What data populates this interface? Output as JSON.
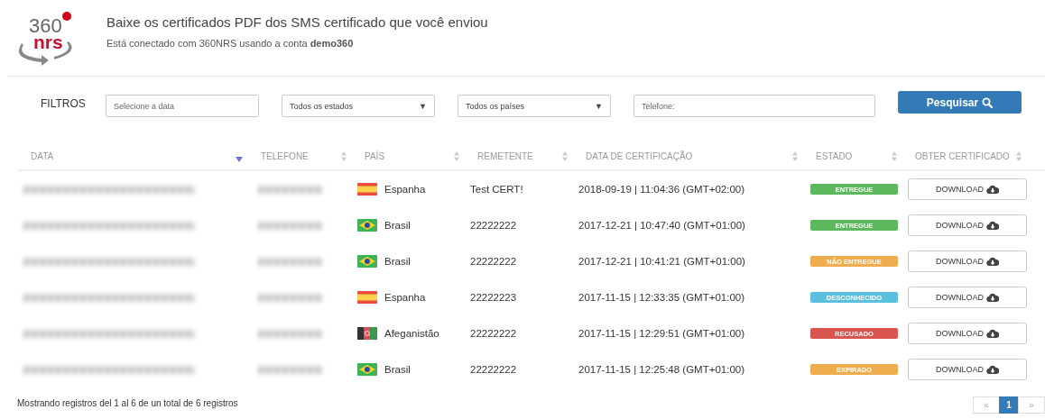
{
  "header": {
    "title": "Baixe os certificados PDF dos SMS certificado que você enviou",
    "subtitle": "Está conectado com 360NRS usando a conta **demo360**",
    "logo_text": "360",
    "logo_brand": "nrs"
  },
  "filters": {
    "label": "FILTROS",
    "date": {
      "placeholder": "Selecione a data"
    },
    "state": {
      "value": "Todos os estados",
      "arrow": "▼"
    },
    "country": {
      "value": "Todos os países",
      "arrow": "▼"
    },
    "phone": {
      "placeholder": "Telefone:"
    },
    "search_button": "Pesquisar"
  },
  "table": {
    "columns": [
      {
        "label": "DATA",
        "sorted": true
      },
      {
        "label": "TELEFONE",
        "sorted": false
      },
      {
        "label": "PAÍS",
        "sorted": false
      },
      {
        "label": "REMETENTE",
        "sorted": false
      },
      {
        "label": "DATA DE CERTIFICAÇÃO",
        "sorted": false
      },
      {
        "label": "ESTADO",
        "sorted": false
      },
      {
        "label": "OBTER CERTIFICADO",
        "sorted": false
      }
    ],
    "rows": [
      {
        "kind": "spain",
        "country": "Espanha",
        "sender": "Test CERT!",
        "certified": "2018-09-19 | 11:04:36 (GMT+02:00)",
        "status": "ENTREGUE",
        "color": "#5cb85c",
        "action": "DOWNLOAD"
      },
      {
        "kind": "brazil",
        "country": "Brasil",
        "sender": "22222222",
        "certified": "2017-12-21 | 10:47:40 (GMT+01:00)",
        "status": "ENTREGUE",
        "color": "#5cb85c",
        "action": "DOWNLOAD"
      },
      {
        "kind": "brazil",
        "country": "Brasil",
        "sender": "22222222",
        "certified": "2017-12-21 | 10:41:21 (GMT+01:00)",
        "status": "NÃO ENTREGUE",
        "color": "#f0ad4e",
        "action": "DOWNLOAD"
      },
      {
        "kind": "spain",
        "country": "Espanha",
        "sender": "22222223",
        "certified": "2017-11-15 | 12:33:35 (GMT+01:00)",
        "status": "DESCONHECIDO",
        "color": "#5bc0de",
        "action": "DOWNLOAD"
      },
      {
        "kind": "afghanistan",
        "country": "Afeganistão",
        "sender": "22222222",
        "certified": "2017-11-15 | 12:29:51 (GMT+01:00)",
        "status": "RECUSADO",
        "color": "#d9534f",
        "action": "DOWNLOAD"
      },
      {
        "kind": "brazil",
        "country": "Brasil",
        "sender": "22222222",
        "certified": "2017-11-15 | 12:25:48 (GMT+01:00)",
        "status": "EXPIRADO",
        "color": "#f0ad4e",
        "action": "DOWNLOAD"
      }
    ]
  },
  "footer": {
    "info": "Mostrando registros del 1 al 6 de un total de 6 registros",
    "pages": [
      {
        "label": "«",
        "selected": false
      },
      {
        "label": "1",
        "selected": true
      },
      {
        "label": "»",
        "selected": false
      }
    ]
  }
}
